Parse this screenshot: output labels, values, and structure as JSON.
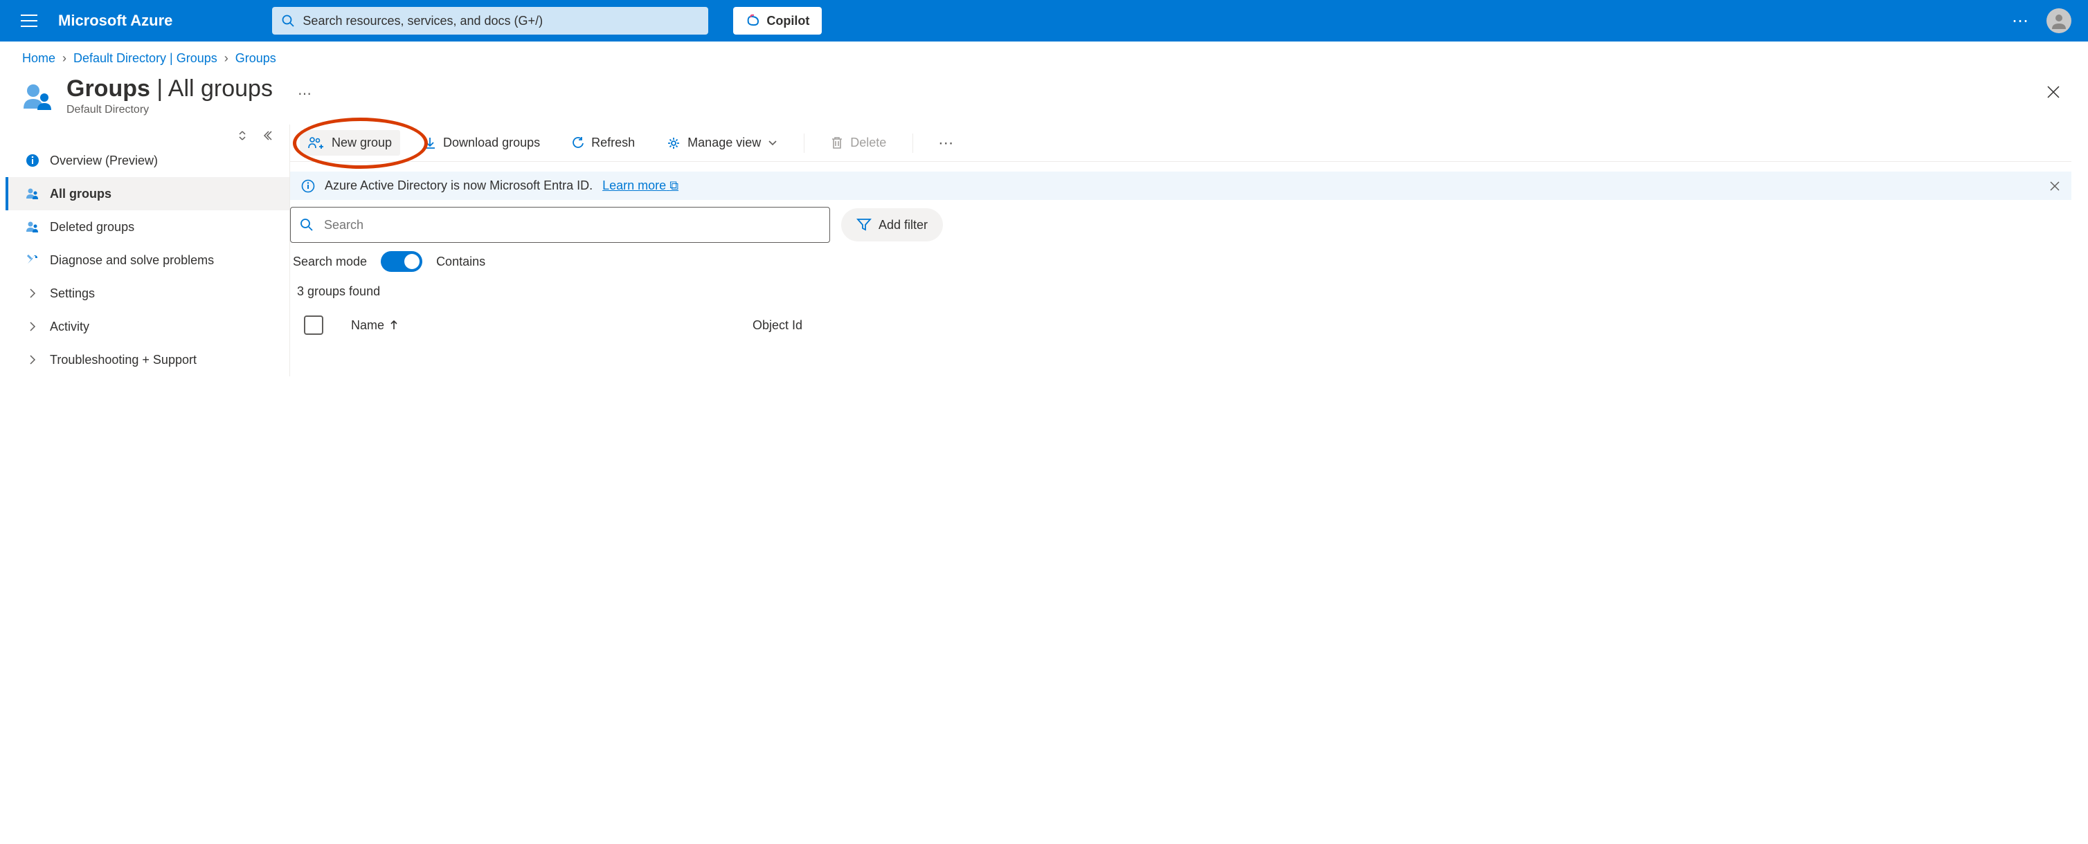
{
  "header": {
    "brand": "Microsoft Azure",
    "search_placeholder": "Search resources, services, and docs (G+/)",
    "copilot_label": "Copilot"
  },
  "breadcrumb": {
    "items": [
      "Home",
      "Default Directory | Groups",
      "Groups"
    ]
  },
  "title": {
    "main": "Groups",
    "suffix": "All groups",
    "subtitle": "Default Directory"
  },
  "sidebar": {
    "items": [
      {
        "label": "Overview (Preview)",
        "icon": "info"
      },
      {
        "label": "All groups",
        "icon": "people",
        "active": true
      },
      {
        "label": "Deleted groups",
        "icon": "people"
      },
      {
        "label": "Diagnose and solve problems",
        "icon": "wrench"
      },
      {
        "label": "Settings",
        "icon": "chevron"
      },
      {
        "label": "Activity",
        "icon": "chevron"
      },
      {
        "label": "Troubleshooting + Support",
        "icon": "chevron"
      }
    ]
  },
  "toolbar": {
    "new_group": "New group",
    "download": "Download groups",
    "refresh": "Refresh",
    "manage_view": "Manage view",
    "delete": "Delete"
  },
  "banner": {
    "text": "Azure Active Directory is now Microsoft Entra ID.",
    "link": "Learn more"
  },
  "filter": {
    "search_placeholder": "Search",
    "add_filter": "Add filter"
  },
  "search_mode": {
    "label": "Search mode",
    "value": "Contains"
  },
  "results": {
    "count_text": "3 groups found"
  },
  "columns": {
    "name": "Name",
    "object_id": "Object Id"
  }
}
